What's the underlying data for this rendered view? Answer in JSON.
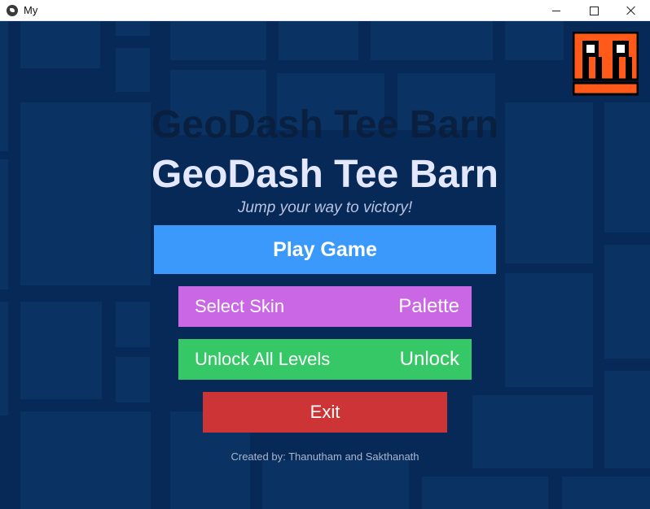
{
  "window": {
    "title": "My",
    "app_icon": "kivy-icon",
    "controls": [
      "minimize-icon",
      "maximize-icon",
      "close-icon"
    ]
  },
  "game": {
    "background_color": "#072957",
    "logo_icon": "geometry-dash-cube-face-icon",
    "logo_color": "#ff5a1a",
    "title": "GeoDash Tee Barn",
    "title_shadow": "GeoDash Tee Barn",
    "subtitle": "Jump your way to victory!",
    "buttons": {
      "play": {
        "label": "Play Game",
        "color": "#3a99fb"
      },
      "select_skin": {
        "label": "Select Skin",
        "right_label": "Palette",
        "color": "#c967e5"
      },
      "unlock_levels": {
        "label": "Unlock All Levels",
        "right_label": "Unlock",
        "color": "#36c866"
      },
      "exit": {
        "label": "Exit",
        "color": "#cd3435"
      }
    },
    "credits": "Created by: Thanutham and Sakthanath"
  }
}
